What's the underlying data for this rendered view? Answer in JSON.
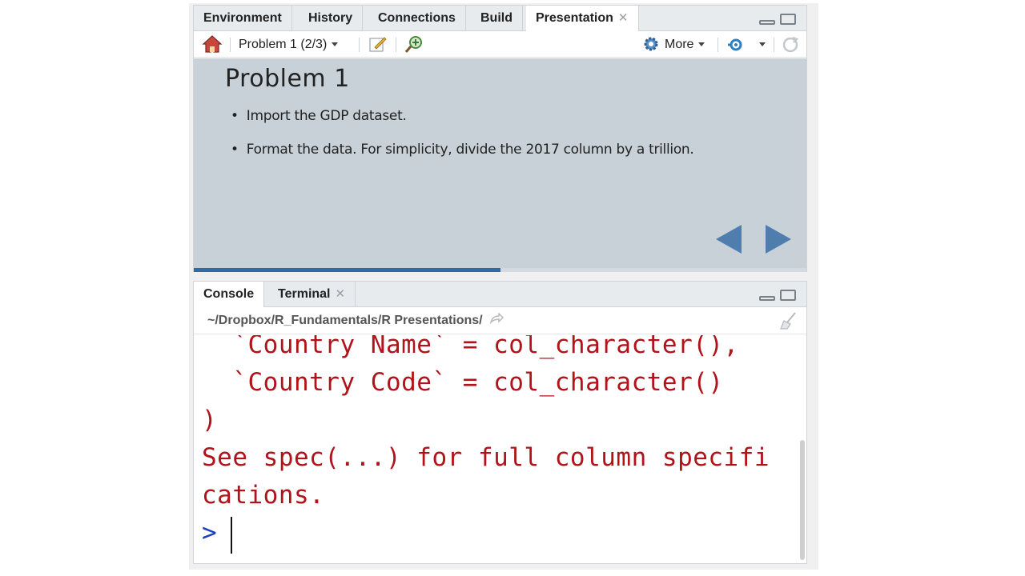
{
  "top_pane": {
    "tabs": [
      {
        "label": "Environment"
      },
      {
        "label": "History"
      },
      {
        "label": "Connections"
      },
      {
        "label": "Build"
      },
      {
        "label": "Presentation",
        "closable": true,
        "active": true
      }
    ],
    "toolbar": {
      "home_icon": "home-icon",
      "slide_selector": "Problem 1 (2/3)",
      "more_label": "More"
    },
    "slide": {
      "title": "Problem 1",
      "bullets": [
        "Import the GDP dataset.",
        "Format the data. For simplicity, divide the 2017 column by a trillion."
      ],
      "progress_fraction": 0.5,
      "background": "#c7d1d7",
      "accent": "#4f7eae"
    }
  },
  "bottom_pane": {
    "tabs": [
      {
        "label": "Console",
        "active": true
      },
      {
        "label": "Terminal",
        "closable": true
      }
    ],
    "path": "~/Dropbox/R_Fundamentals/R Presentations/",
    "console_lines": [
      "  `Country Name` = col_character(),",
      "  `Country Code` = col_character()",
      ")",
      "See spec(...) for full column specifi",
      "cations."
    ],
    "prompt": ">",
    "error_color": "#b0131a",
    "prompt_color": "#1c3fbf"
  }
}
